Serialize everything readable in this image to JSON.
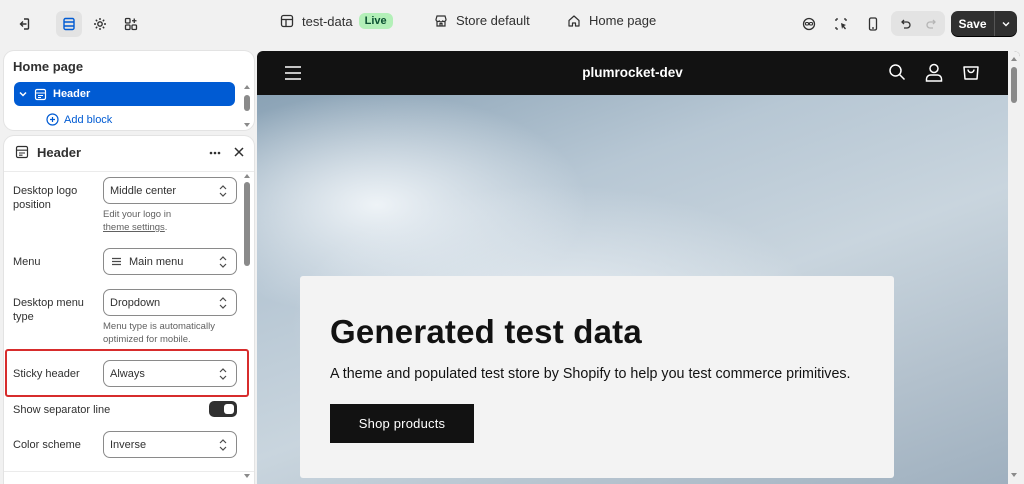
{
  "topbar": {
    "theme_name": "test-data",
    "live_badge": "Live",
    "store_label": "Store default",
    "page_label": "Home page",
    "save_label": "Save"
  },
  "tree": {
    "title": "Home page",
    "selected_item": "Header",
    "add_block": "Add block"
  },
  "settings": {
    "title": "Header",
    "logo_position": {
      "label_line1": "Desktop logo",
      "label_line2": "position",
      "value": "Middle center",
      "help_line1": "Edit your logo in",
      "help_link": "theme settings",
      "help_end": "."
    },
    "menu": {
      "label": "Menu",
      "value": "Main menu"
    },
    "menu_type": {
      "label_line1": "Desktop menu",
      "label_line2": "type",
      "value": "Dropdown",
      "help_line1": "Menu type is automatically",
      "help_line2": "optimized for mobile."
    },
    "sticky_header": {
      "label": "Sticky header",
      "value": "Always"
    },
    "separator_line": {
      "label": "Show separator line",
      "enabled": true
    },
    "color_scheme": {
      "label": "Color scheme",
      "value": "Inverse"
    }
  },
  "preview": {
    "store_name": "plumrocket-dev",
    "hero_title": "Generated test data",
    "hero_subtitle": "A theme and populated test store by Shopify to help you test commerce primitives.",
    "hero_button": "Shop products"
  },
  "colors": {
    "accent": "#005bd3",
    "highlight": "#d72c2c",
    "dark": "#121212",
    "live_bg": "#b3f0b8"
  }
}
